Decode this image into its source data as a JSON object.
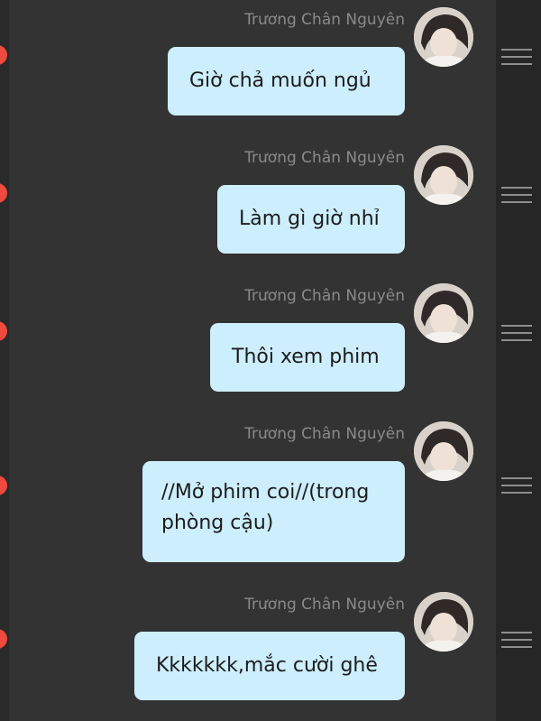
{
  "messages": [
    {
      "sender": "Trương Chân Nguyên",
      "text": "Giờ chả muốn ngủ"
    },
    {
      "sender": "Trương Chân Nguyên",
      "text": "Làm gì giờ nhỉ"
    },
    {
      "sender": "Trương Chân Nguyên",
      "text": "Thôi xem phim"
    },
    {
      "sender": "Trương Chân Nguyên",
      "text": "//Mở phim coi//(trong phòng cậu)"
    },
    {
      "sender": "Trương Chân Nguyên",
      "text": "Kkkkkkk,mắc cười ghê"
    }
  ],
  "icons": {
    "avatar": "profile-photo",
    "menu": "drag-handle-icon",
    "indicator": "red-dot"
  },
  "colors": {
    "background": "#333333",
    "bubble": "#cdeefc",
    "sender_name": "#8a8a8a",
    "indicator": "#f04a3e"
  }
}
